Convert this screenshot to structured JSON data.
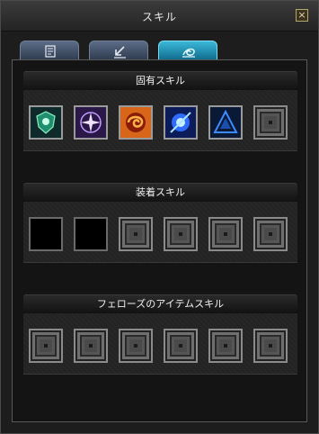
{
  "window": {
    "title": "スキル",
    "close_symbol": "×"
  },
  "tabs": [
    {
      "icon": "document-icon",
      "active": false
    },
    {
      "icon": "arrow-down-left-icon",
      "active": false
    },
    {
      "icon": "swirl-icon",
      "active": true
    }
  ],
  "sections": [
    {
      "title": "固有スキル",
      "slots": [
        "skill-green-shield",
        "skill-purple-star",
        "skill-orange-swirl",
        "skill-blue-orb",
        "skill-blue-triangle",
        "empty"
      ]
    },
    {
      "title": "装着スキル",
      "slots": [
        "black",
        "black",
        "empty",
        "empty",
        "empty",
        "empty"
      ]
    },
    {
      "title": "フェローズのアイテムスキル",
      "slots": [
        "empty",
        "empty",
        "empty",
        "empty",
        "empty",
        "empty"
      ]
    }
  ]
}
